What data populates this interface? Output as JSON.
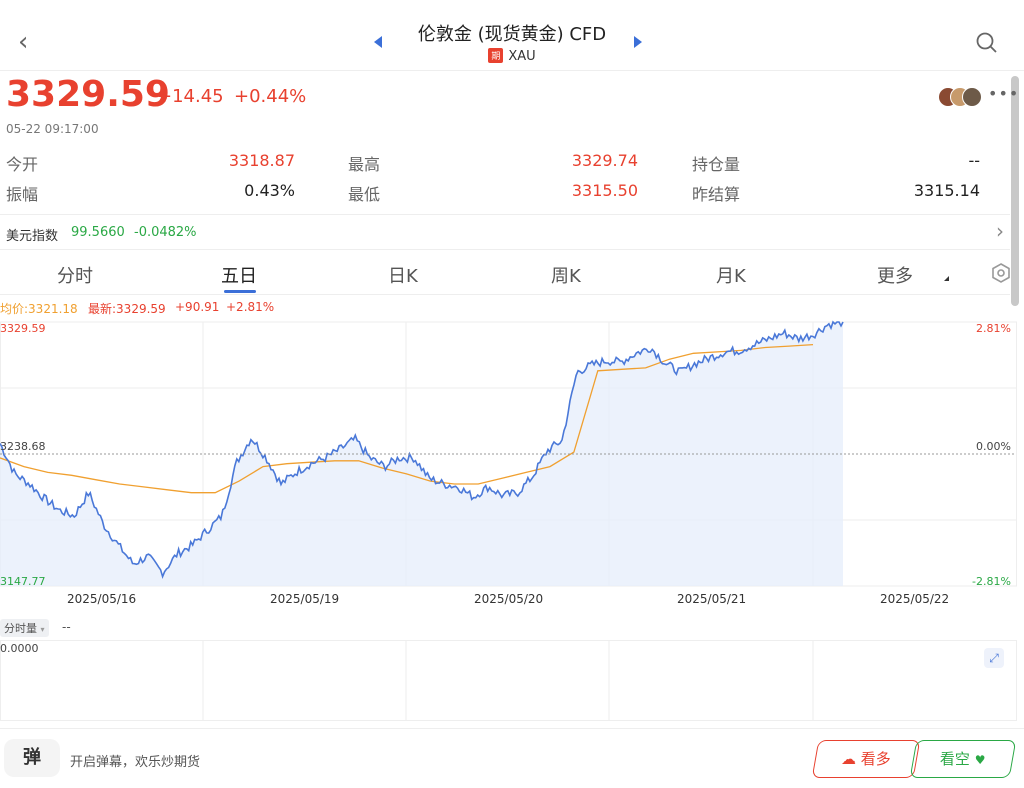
{
  "header": {
    "title": "伦敦金 (现货黄金) CFD",
    "badge": "期",
    "symbol": "XAU"
  },
  "quote": {
    "price": "3329.59",
    "change": "+14.45",
    "change_pct": "+0.44%",
    "timestamp": "05-22 09:17:00"
  },
  "stats": {
    "open_label": "今开",
    "open": "3318.87",
    "high_label": "最高",
    "high": "3329.74",
    "oi_label": "持仓量",
    "oi": "--",
    "amp_label": "振幅",
    "amp": "0.43%",
    "low_label": "最低",
    "low": "3315.50",
    "settle_label": "昨结算",
    "settle": "3315.14"
  },
  "index": {
    "label": "美元指数",
    "value": "99.5660",
    "change": "-0.0482%"
  },
  "tabs": [
    "分时",
    "五日",
    "日K",
    "周K",
    "月K",
    "更多"
  ],
  "chart_legend": {
    "avg": "均价:3321.18",
    "latest": "最新:3329.59",
    "diff": "+90.91",
    "pct": "+2.81%"
  },
  "chart_data": {
    "type": "line",
    "ylim": [
      3147.77,
      3329.59
    ],
    "y_labels": {
      "top": "3329.59",
      "mid": "3238.68",
      "bottom": "3147.77"
    },
    "right_labels": {
      "top": "2.81%",
      "mid": "0.00%",
      "bottom": "-2.81%"
    },
    "x_labels": [
      "2025/05/16",
      "2025/05/19",
      "2025/05/20",
      "2025/05/21",
      "2025/05/22"
    ],
    "series": [
      {
        "name": "最新",
        "values": [
          3246,
          3225,
          3218,
          3208,
          3200,
          3196,
          3212,
          3190,
          3176,
          3163,
          3168,
          3157,
          3170,
          3176,
          3186,
          3196,
          3233,
          3250,
          3236,
          3218,
          3226,
          3232,
          3236,
          3242,
          3249,
          3236,
          3230,
          3236,
          3236,
          3222,
          3218,
          3216,
          3209,
          3216,
          3210,
          3212,
          3223,
          3241,
          3248,
          3295,
          3300,
          3303,
          3302,
          3308,
          3312,
          3301,
          3295,
          3301,
          3305,
          3309,
          3310,
          3314,
          3318,
          3322,
          3318,
          3321,
          3328,
          3329.59
        ]
      },
      {
        "name": "均价",
        "values": [
          3236,
          3230,
          3226,
          3224,
          3221,
          3218,
          3216,
          3214,
          3212,
          3212,
          3220,
          3230,
          3232,
          3233,
          3234,
          3234,
          3229,
          3225,
          3220,
          3218,
          3218,
          3222,
          3226,
          3230,
          3240,
          3296,
          3297,
          3298,
          3304,
          3308,
          3309,
          3310,
          3312,
          3313,
          3314
        ]
      }
    ]
  },
  "volume": {
    "tab": "分时量",
    "value": "--",
    "axis": "0.0000"
  },
  "footer": {
    "danmu_icon": "弹",
    "danmu_text": "开启弹幕，欢乐炒期货",
    "long_label": "看多",
    "short_label": "看空"
  },
  "colors": {
    "up": "#e8412f",
    "down": "#2aa845",
    "line": "#4a78d8",
    "avg": "#f0a030"
  }
}
